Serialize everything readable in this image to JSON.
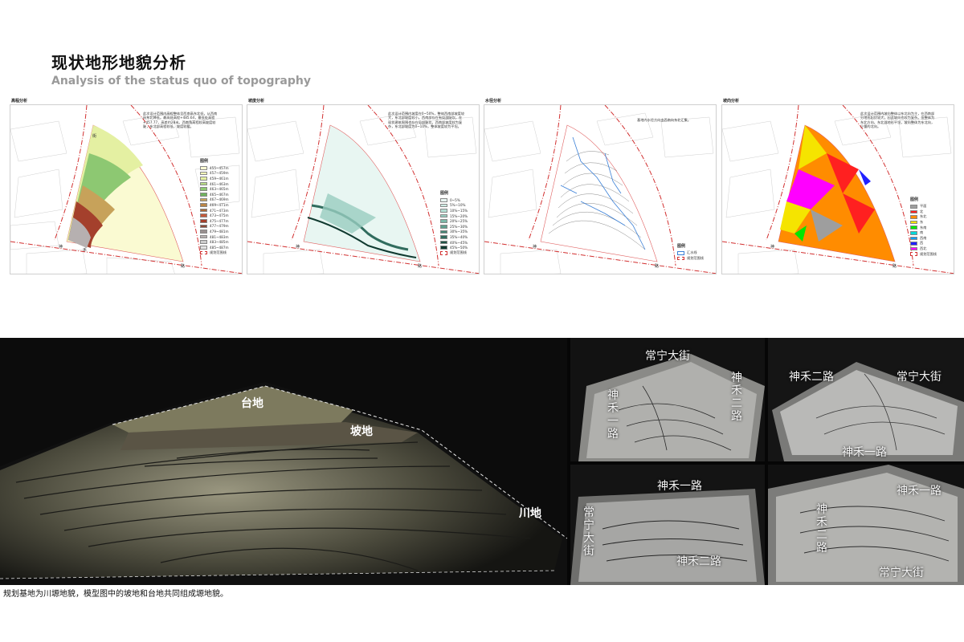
{
  "header": {
    "title_cn": "现状地形地貌分析",
    "title_en": "Analysis of the status quo of topography"
  },
  "road_labels": {
    "shen": "神",
    "he": "禾",
    "lu": "路",
    "jie": "街"
  },
  "panels": [
    {
      "label": "高程分析",
      "desc": "此次设计范围内高程整体呈西南高东北低，从西南向东北降低。最高处高程+485.64，最低处高程+457.77，高差约28米。西南角高程较高坡度较陡，东北部高程较低，坡度较缓。",
      "legend_title": "图例",
      "legend": [
        {
          "text": "455~457m",
          "color": "#fafad2"
        },
        {
          "text": "457~459m",
          "color": "#f3f7b8"
        },
        {
          "text": "459~461m",
          "color": "#e4f0a2"
        },
        {
          "text": "461~463m",
          "color": "#b8dc86"
        },
        {
          "text": "463~465m",
          "color": "#8dc872"
        },
        {
          "text": "465~467m",
          "color": "#6fb35e"
        },
        {
          "text": "467~469m",
          "color": "#c7a25a"
        },
        {
          "text": "469~471m",
          "color": "#b98546"
        },
        {
          "text": "471~473m",
          "color": "#a86a38"
        },
        {
          "text": "473~475m",
          "color": "#c45a3a"
        },
        {
          "text": "475~477m",
          "color": "#a4402c"
        },
        {
          "text": "477~479m",
          "color": "#8a4a3a"
        },
        {
          "text": "479~481m",
          "color": "#9a9090"
        },
        {
          "text": "481~483m",
          "color": "#b6b0b0"
        },
        {
          "text": "483~485m",
          "color": "#cccccc"
        },
        {
          "text": "485~487m",
          "color": "#e2e2e2"
        },
        {
          "text": "规划范围线",
          "color": "#ffffff"
        }
      ]
    },
    {
      "label": "坡度分析",
      "desc": "此次设计范围内坡度在0~50%，整体西南部坡度较大，东北部坡度较小。西南部存在有局部陡坎，在现状建筑周围也存在局部陡坎。西南部坡度较为复杂，东北部坡度为0~10%，整体坡度较为平坦。",
      "legend_title": "图例",
      "legend": [
        {
          "text": "0~5%",
          "color": "#e8f6f2"
        },
        {
          "text": "5%~10%",
          "color": "#cdebe3"
        },
        {
          "text": "10%~15%",
          "color": "#b3ded3"
        },
        {
          "text": "15%~20%",
          "color": "#98cdbf"
        },
        {
          "text": "20%~25%",
          "color": "#7cb8a8"
        },
        {
          "text": "25%~30%",
          "color": "#5f9f8e"
        },
        {
          "text": "30%~35%",
          "color": "#468676"
        },
        {
          "text": "35%~40%",
          "color": "#316c5e"
        },
        {
          "text": "40%~45%",
          "color": "#205346"
        },
        {
          "text": "45%~50%",
          "color": "#103a30"
        },
        {
          "text": "规划范围线",
          "color": "#ffffff"
        }
      ]
    },
    {
      "label": "水径分析",
      "desc": "基地内水径方向由西南向东北汇集。",
      "legend_title": "图例",
      "legend": [
        {
          "text": "汇水线",
          "color": "#3a7fd6"
        },
        {
          "text": "规划范围线",
          "color": "#ffffff"
        }
      ]
    },
    {
      "label": "坡向分析",
      "desc": "此次设计范围内坡向整体以东北向为主，在西南部分地形起伏较大，因此坡向也较为复杂。但整体为东北方向，东北部地形平坦，坡向整体为东北向，少量的北向。",
      "legend_title": "图例",
      "legend": [
        {
          "text": "平面",
          "color": "#9e9e9e"
        },
        {
          "text": "北",
          "color": "#ff2020"
        },
        {
          "text": "东北",
          "color": "#ff8c00"
        },
        {
          "text": "东",
          "color": "#f5e400"
        },
        {
          "text": "东南",
          "color": "#00e600"
        },
        {
          "text": "南",
          "color": "#00d8d8"
        },
        {
          "text": "西南",
          "color": "#00a0ff"
        },
        {
          "text": "西",
          "color": "#2020ff"
        },
        {
          "text": "西北",
          "color": "#ff00ff"
        },
        {
          "text": "规划范围线",
          "color": "#ffffff"
        }
      ]
    }
  ],
  "model_photos": {
    "main": {
      "taidi": "台地",
      "podi": "坡地",
      "chuandi": "川地"
    },
    "photo2": {
      "a": "常宁大街",
      "b": "神禾一路",
      "c": "神禾二路"
    },
    "photo3": {
      "a": "神禾二路",
      "b": "常宁大街",
      "c": "神禾一路"
    },
    "photo4": {
      "a": "神禾一路",
      "b": "常宁大街",
      "c": "神禾二路"
    },
    "photo5": {
      "a": "神禾二路",
      "b": "神禾一路",
      "c": "常宁大街"
    }
  },
  "caption": "规划基地为川塬地貌，模型图中的坡地和台地共同组成塬地貌。"
}
